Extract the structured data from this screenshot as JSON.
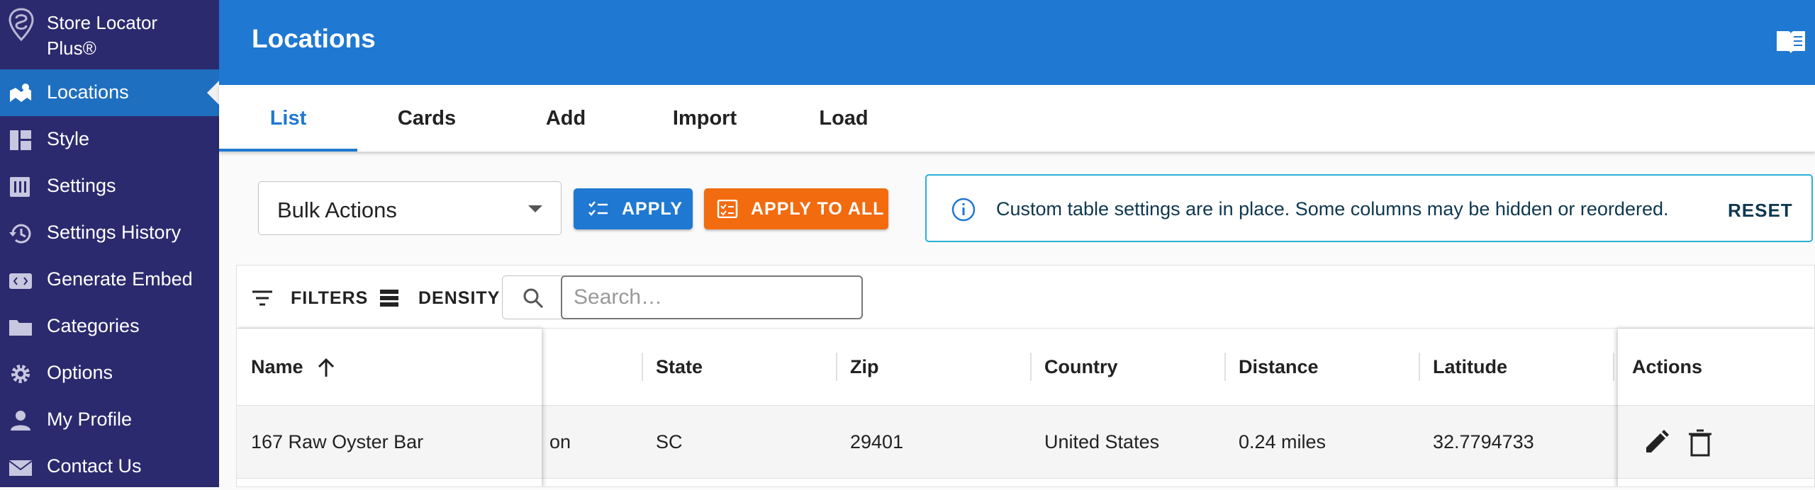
{
  "app": {
    "brand": "Store Locator Plus®"
  },
  "sidebar": {
    "items": [
      {
        "label": "Locations",
        "icon": "map-icon",
        "active": true
      },
      {
        "label": "Style",
        "icon": "layout-icon"
      },
      {
        "label": "Settings",
        "icon": "sliders-icon"
      },
      {
        "label": "Settings History",
        "icon": "history-icon"
      },
      {
        "label": "Generate Embed",
        "icon": "embed-icon"
      },
      {
        "label": "Categories",
        "icon": "folder-icon"
      },
      {
        "label": "Options",
        "icon": "gear-icon"
      },
      {
        "label": "My Profile",
        "icon": "user-icon"
      },
      {
        "label": "Contact Us",
        "icon": "mail-icon"
      }
    ]
  },
  "header": {
    "title": "Locations",
    "docs_icon": "book-icon"
  },
  "tabs": [
    {
      "label": "List",
      "active": true
    },
    {
      "label": "Cards"
    },
    {
      "label": "Add"
    },
    {
      "label": "Import"
    },
    {
      "label": "Load"
    }
  ],
  "toolbar": {
    "bulk_actions": "Bulk Actions",
    "apply_label": "APPLY",
    "apply_all_label": "APPLY TO ALL"
  },
  "notice": {
    "message": "Custom table settings are in place. Some columns may be hidden or reordered.",
    "reset_label": "RESET"
  },
  "grid": {
    "filters_label": "FILTERS",
    "density_label": "DENSITY",
    "search_placeholder": "Search…",
    "columns": {
      "name": "Name",
      "state": "State",
      "zip": "Zip",
      "country": "Country",
      "distance": "Distance",
      "latitude": "Latitude",
      "actions": "Actions"
    },
    "rows": [
      {
        "name": "167 Raw Oyster Bar",
        "city_partial": "on",
        "state": "SC",
        "zip": "29401",
        "country": "United States",
        "distance": "0.24 miles",
        "latitude": "32.7794733"
      }
    ]
  },
  "colors": {
    "sidebar_bg": "#2c2a6e",
    "active_item": "#1f6fc0",
    "header_bg": "#1f78d1",
    "apply_button": "#1f78d1",
    "apply_all_button": "#f26b0f",
    "notice_border": "#29b0d8"
  }
}
